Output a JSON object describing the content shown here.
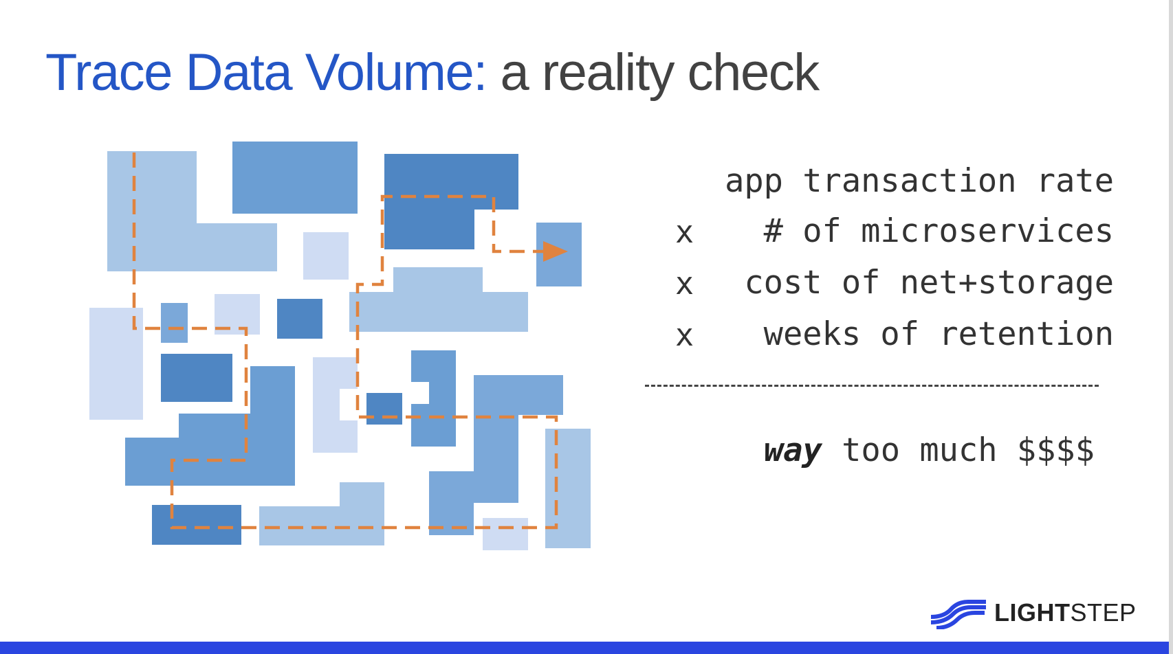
{
  "slide": {
    "title": {
      "main": "Trace Data Volume:",
      "rest": " a reality check"
    },
    "formula": {
      "line1": "app transaction rate",
      "multiplier": "x",
      "line2": "# of microservices",
      "line3": "cost of net+storage",
      "line4": "weeks of retention",
      "result_emphasis": "way",
      "result_rest": " too much $$$$"
    },
    "logo": {
      "text_bold": "LIGHT",
      "text_light": "STEP"
    }
  },
  "colors": {
    "title_blue": "#2456c6",
    "title_gray": "#424242",
    "path_orange": "#e0833f",
    "block_dark": "#4f86c3",
    "block_medium": "#6b9ed3",
    "block_light": "#a8c6e6",
    "block_pale": "#cfdcf3",
    "bottom_bar": "#2a45e0"
  }
}
